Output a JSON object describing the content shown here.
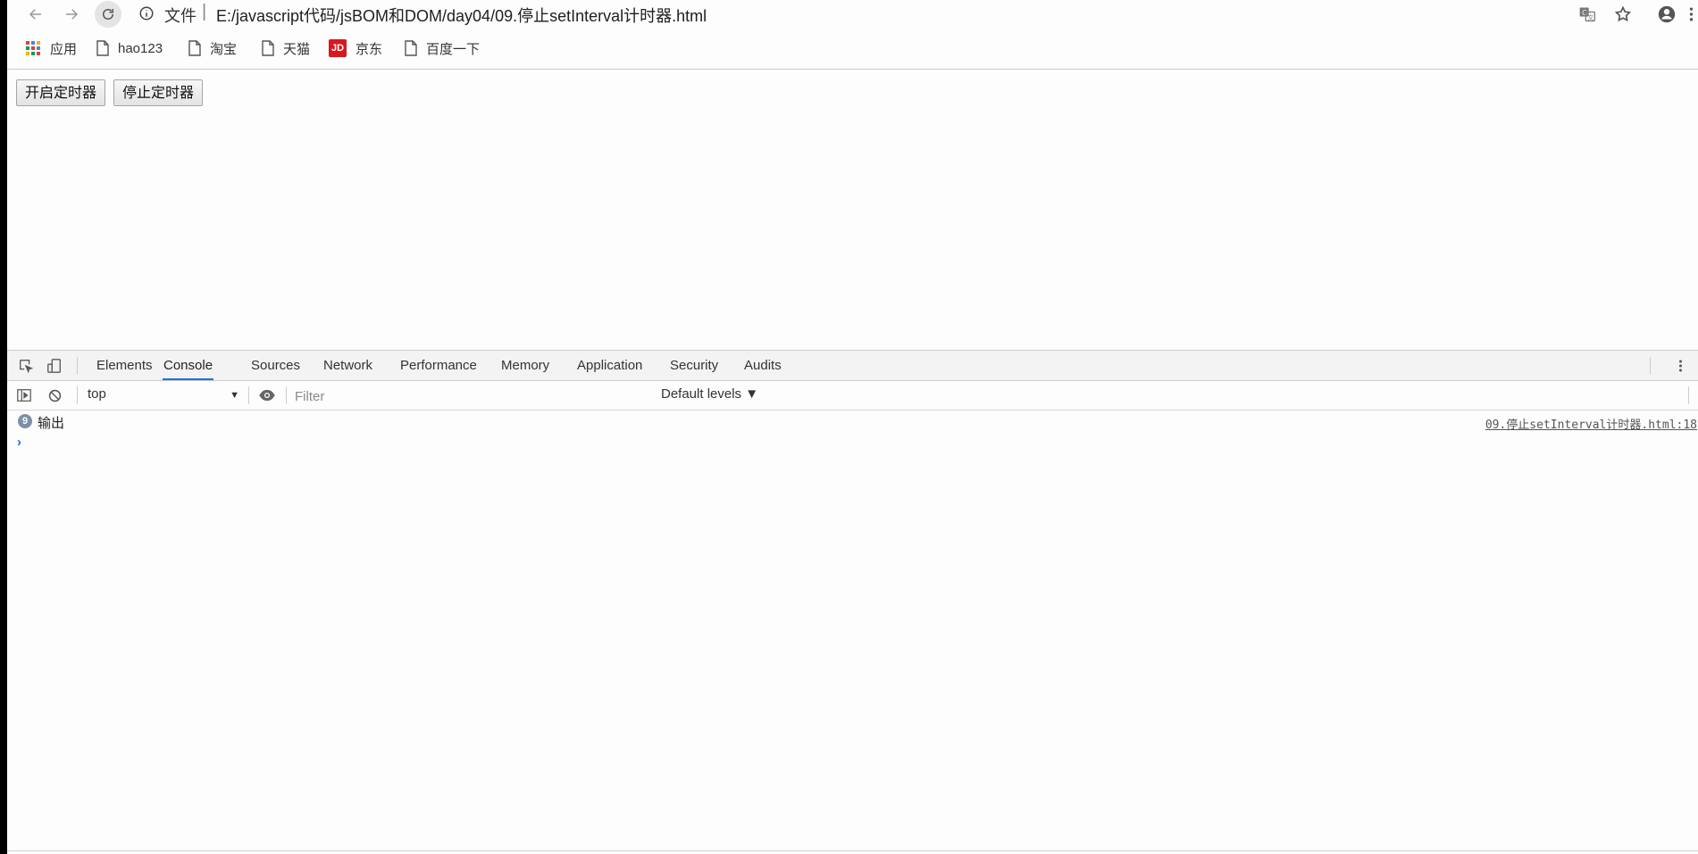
{
  "browser": {
    "site_info_label": "文件",
    "separator": "|",
    "url": "E:/javascript代码/jsBOM和DOM/day04/09.停止setInterval计时器.html",
    "icons": {
      "back": "arrow-left-icon",
      "forward": "arrow-right-icon",
      "reload": "reload-icon",
      "info": "info-icon",
      "translate": "translate-icon",
      "bookmark": "star-icon",
      "account": "account-icon",
      "menu": "kebab-menu-icon"
    }
  },
  "bookmarks": [
    {
      "label": "应用",
      "icon": "apps-grid-icon"
    },
    {
      "label": "hao123",
      "icon": "page-icon"
    },
    {
      "label": "淘宝",
      "icon": "page-icon"
    },
    {
      "label": "天猫",
      "icon": "page-icon"
    },
    {
      "label": "京东",
      "icon": "jd-logo-icon",
      "logo_text": "JD"
    },
    {
      "label": "百度一下",
      "icon": "page-icon"
    }
  ],
  "page": {
    "start_button": "开启定时器",
    "stop_button": "停止定时器"
  },
  "devtools": {
    "tabs": [
      {
        "label": "Elements",
        "active": false
      },
      {
        "label": "Console",
        "active": true
      },
      {
        "label": "Sources",
        "active": false
      },
      {
        "label": "Network",
        "active": false
      },
      {
        "label": "Performance",
        "active": false
      },
      {
        "label": "Memory",
        "active": false
      },
      {
        "label": "Application",
        "active": false
      },
      {
        "label": "Security",
        "active": false
      },
      {
        "label": "Audits",
        "active": false
      }
    ],
    "context": "top",
    "filter_placeholder": "Filter",
    "levels_label": "Default levels ▼",
    "accent_color": "#1a73e8"
  },
  "console": {
    "entries": [
      {
        "count": "9",
        "message": "输出",
        "source": "09.停止setInterval计时器.html:18"
      }
    ],
    "prompt": "›"
  }
}
